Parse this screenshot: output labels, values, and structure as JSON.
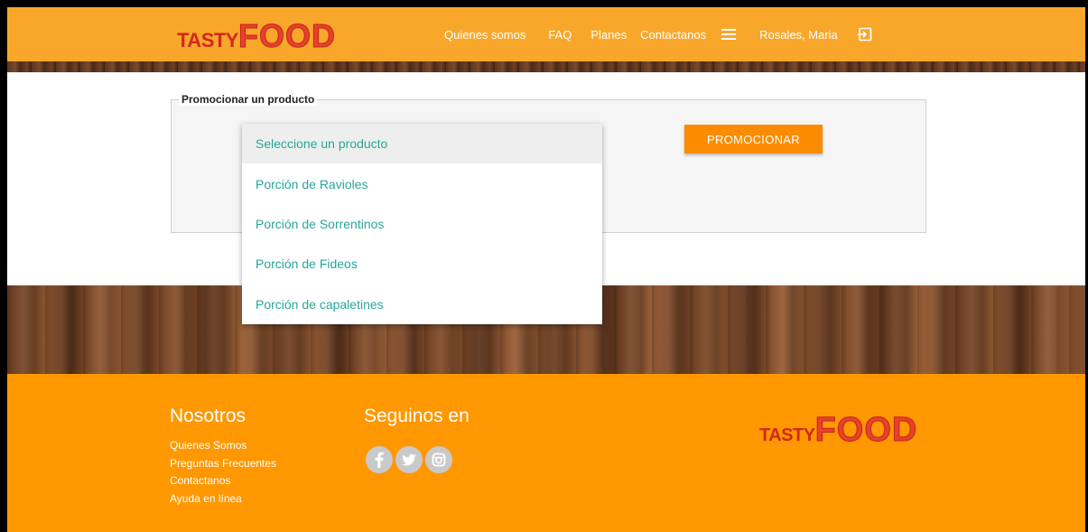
{
  "brand": {
    "tasty": "TASTY",
    "food": "FOOD"
  },
  "nav": {
    "items": [
      "Quienes somos",
      "FAQ",
      "Planes",
      "Contactanos"
    ],
    "user": "Rosales, Maria",
    "menu_icon": "hamburger-menu-icon",
    "logout_icon": "logout-icon"
  },
  "promote": {
    "legend": "Promocionar un producto",
    "button": "PROMOCIONAR"
  },
  "dropdown": {
    "selected": "Seleccione un producto",
    "options": [
      "Seleccione un producto",
      "Porción de Ravioles",
      "Porción de Sorrentinos",
      "Porción de Fideos",
      "Porción de capaletines"
    ]
  },
  "footer": {
    "nosotros_title": "Nosotros",
    "nosotros_links": [
      "Quienes Somos",
      "Preguntas Frecuentes",
      "Contactanos",
      "Ayuda en línea"
    ],
    "seguinos_title": "Seguinos en",
    "social_icons": [
      "facebook-icon",
      "twitter-icon",
      "instagram-icon"
    ]
  },
  "colors": {
    "header": "#f9a72b",
    "footer": "#ff9800",
    "button": "#fb8c00",
    "option_text": "#26a69a",
    "logo_red": "#d2281c"
  }
}
